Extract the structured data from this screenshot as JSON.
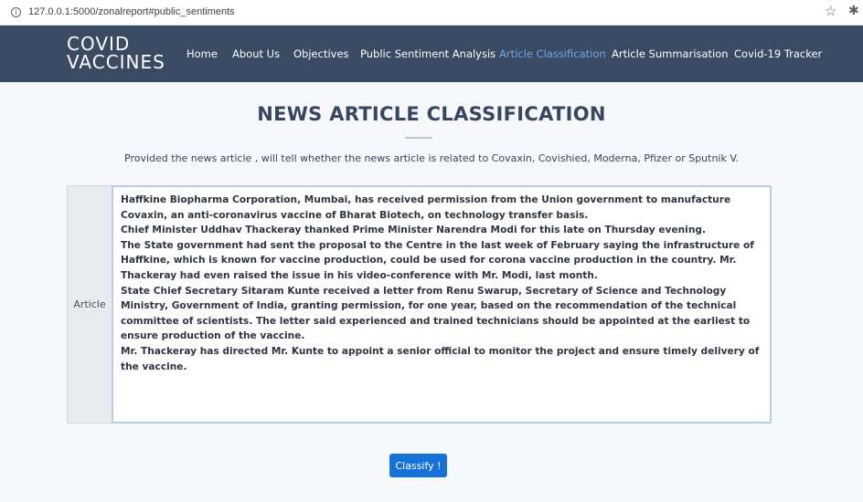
{
  "browser": {
    "info_icon": "info-icon",
    "url": "127.0.0.1:5000/zonalreport#public_sentiments",
    "star_icon": "star-icon",
    "extension_icon": "puzzle-icon"
  },
  "navbar": {
    "logo_line1": "COVID",
    "logo_line2": "VACCINES",
    "items": [
      {
        "label": "Home"
      },
      {
        "label": "About Us"
      },
      {
        "label": "Objectives"
      },
      {
        "label": "Public Sentiment Analysis"
      },
      {
        "label": "Article Classification",
        "active": true
      },
      {
        "label": "Article Summarisation"
      },
      {
        "label": "Covid-19 Tracker"
      }
    ],
    "bg_color": "#3b4a63",
    "active_color": "#6fa8e8"
  },
  "main": {
    "title": "NEWS ARTICLE CLASSIFICATION",
    "subtitle": "Provided the news article , will tell whether the news article is related to Covaxin, Covishied, Moderna, Pfizer or Sputnik V.",
    "field_label": "Article",
    "article_text": "Haffkine Biopharma Corporation, Mumbai, has received permission from the Union government to manufacture Covaxin, an anti-coronavirus vaccine of Bharat Biotech, on technology transfer basis.\nChief Minister Uddhav Thackeray thanked Prime Minister Narendra Modi for this late on Thursday evening.\nThe State government had sent the proposal to the Centre in the last week of February saying the infrastructure of Haffkine, which is known for vaccine production, could be used for corona vaccine production in the country. Mr. Thackeray had even raised the issue in his video-conference with Mr. Modi, last month.\nState Chief Secretary Sitaram Kunte received a letter from Renu Swarup, Secretary of Science and Technology Ministry, Government of India, granting permission, for one year, based on the recommendation of the technical committee of scientists. The letter said experienced and trained technicians should be appointed at the earliest to ensure production of the vaccine.\nMr. Thackeray has directed Mr. Kunte to appoint a senior official to monitor the project and ensure timely delivery of the vaccine.",
    "button_label": "Classify !",
    "button_color": "#1671d9"
  }
}
